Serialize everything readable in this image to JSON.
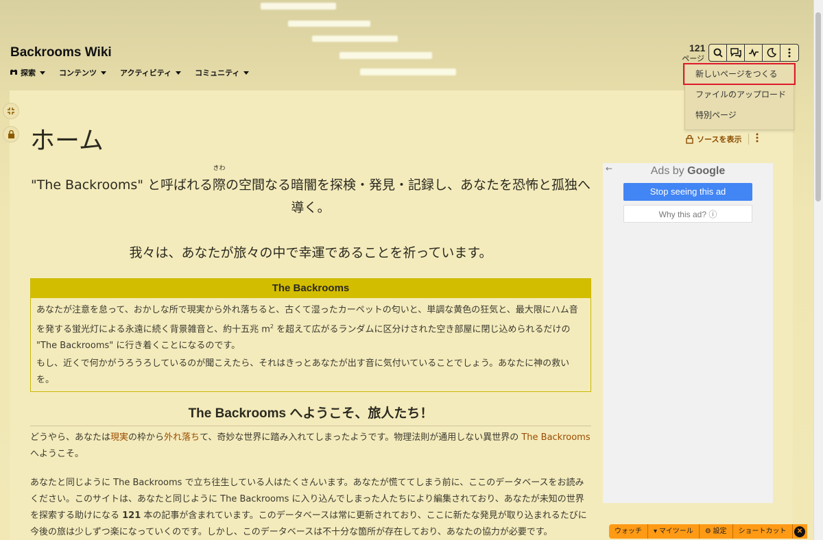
{
  "site": {
    "title": "Backrooms Wiki",
    "nav": [
      {
        "icon": "home-icon",
        "label": "探索"
      },
      {
        "icon": "",
        "label": "コンテンツ"
      },
      {
        "icon": "",
        "label": "アクティビティ"
      },
      {
        "icon": "",
        "label": "コミュニティ"
      }
    ],
    "page_count": "121",
    "page_count_label": "ページ"
  },
  "toolbar": {
    "buttons": [
      "search-icon",
      "discussions-icon",
      "activity-icon",
      "dark-mode-icon",
      "more-options-icon"
    ]
  },
  "dropdown": {
    "items": [
      "新しいページをつくる",
      "ファイルのアップロード",
      "特別ページ"
    ]
  },
  "page": {
    "heading": "ホーム",
    "view_source": "ソースを表示",
    "intro_before": "\"The Backrooms\" と呼ばれる",
    "intro_ruby_base": "際",
    "intro_ruby_text": "きわ",
    "intro_after": "の空間なる暗闇を探検・発見・記録し、あなたを恐怖と孤独へ導く。",
    "intro_2": "我々は、あなたが旅々の中で幸運であることを祈っています。",
    "box": {
      "title": "The Backrooms",
      "p1a": "あなたが注意を怠って、おかしな所で現実から外れ落ちると、古くて湿ったカーペットの匂いと、単調な黄色の狂気と、最大限にハム音を発する蛍光灯による永遠に続く背景雑音と、約十五兆 m",
      "p1sup": "2",
      "p1b": " を超えて広がるランダムに区分けされた空き部屋に閉じ込められるだけの \"The Backrooms\" に行き着くことになるのです。",
      "p2": "もし、近くで何かがうろうろしているのが聞こえたら、それはきっとあなたが出す音に気付いていることでしょう。あなたに神の救いを。"
    },
    "welcome": "The Backrooms へようこそ、旅人たち！",
    "para1": {
      "t1": "どうやら、あなたは",
      "link1": "現実",
      "t2": "の枠から",
      "link2": "外れ落ち",
      "t3": "て、奇妙な世界に踏み入れてしまったようです。物理法則が通用しない異世界の ",
      "link3": "The Backrooms",
      "t4": " へようこそ。"
    },
    "para2": {
      "t1": "あなたと同じように The Backrooms で立ち往生している人はたくさんいます。あなたが慌ててしまう前に、ここのデータベースをお読みください。このサイトは、あなたと同じように The Backrooms に入り込んでしまった人たちにより編集されており、あなたが未知の世界を探索する助けになる ",
      "bold": "121",
      "t2": " 本の記事が含まれています。このデータベースは常に更新されており、ここに新たな発見が取り込まれるたびに今後の旅は少しずつ楽になっていくのです。しかし、このデータベースは不十分な箇所が存在しており、あなたの協力が必要です。"
    }
  },
  "ad": {
    "ads_by": "Ads by",
    "google": "Google",
    "stop": "Stop seeing this ad",
    "why": "Why this ad? ⓘ"
  },
  "bottom_bar": {
    "watch": "ウォッチ",
    "mytools": "マイツール",
    "settings": "設定",
    "shortcuts": "ショートカット"
  }
}
